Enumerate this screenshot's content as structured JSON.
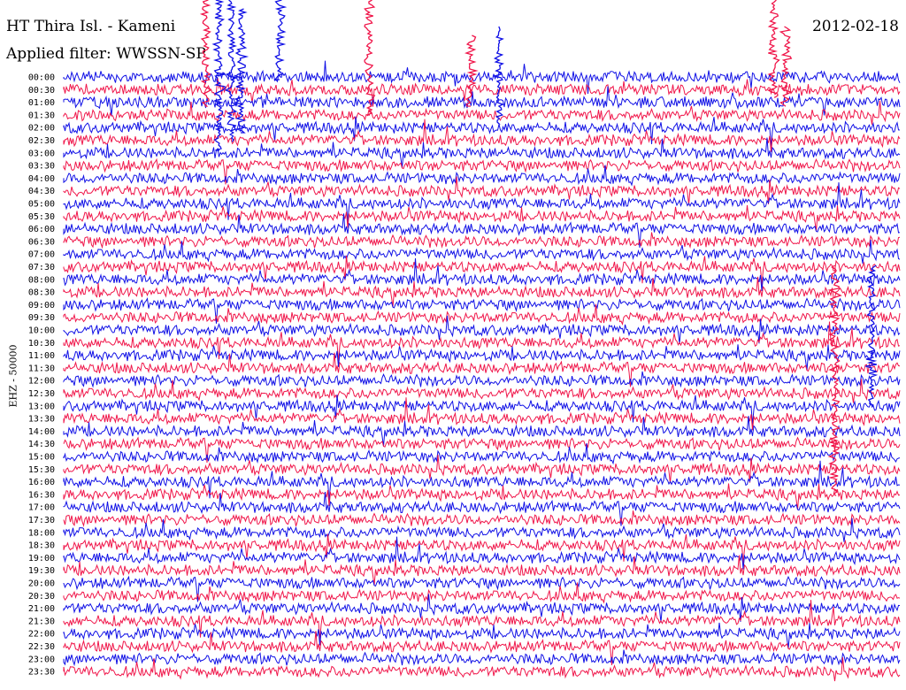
{
  "header": {
    "station": "HT Thira Isl. - Kameni",
    "filter": "Applied filter: WWSSN-SP",
    "date": "2012-02-18"
  },
  "channel_label": "EHZ - 50000",
  "colors": {
    "trace_a": "#1010e6",
    "trace_b": "#f0164a",
    "background": "#ffffff"
  },
  "chart_data": {
    "type": "line",
    "title": "HT Thira Isl. - Kameni",
    "subtitle": "Applied filter: WWSSN-SP",
    "ylabel": "EHZ - 50000",
    "xlabel": "",
    "grid": false,
    "rows": [
      "00:00",
      "00:30",
      "01:00",
      "01:30",
      "02:00",
      "02:30",
      "03:00",
      "03:30",
      "04:00",
      "04:30",
      "05:00",
      "05:30",
      "06:00",
      "06:30",
      "07:00",
      "07:30",
      "08:00",
      "08:30",
      "09:00",
      "09:30",
      "10:00",
      "10:30",
      "11:00",
      "11:30",
      "12:00",
      "12:30",
      "13:00",
      "13:30",
      "14:00",
      "14:30",
      "15:00",
      "15:30",
      "16:00",
      "16:30",
      "17:00",
      "17:30",
      "18:00",
      "18:30",
      "19:00",
      "19:30",
      "20:00",
      "20:30",
      "21:00",
      "21:30",
      "22:00",
      "22:30",
      "23:00",
      "23:30"
    ],
    "trace_colors": [
      "#1010e6",
      "#f0164a"
    ]
  }
}
